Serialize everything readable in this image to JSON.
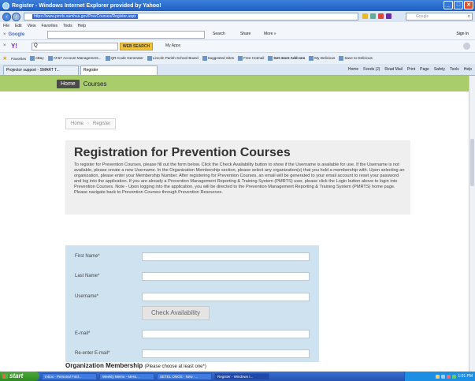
{
  "window": {
    "title": "Register - Windows Internet Explorer provided by Yahoo!",
    "min_label": "_",
    "max_label": "□",
    "close_label": "✕"
  },
  "address": {
    "url": "https://www.pmrts.samhsa.gov/PrevCourses/Register.aspx",
    "search_placeholder": "Google"
  },
  "menu": [
    "File",
    "Edit",
    "View",
    "Favorites",
    "Tools",
    "Help"
  ],
  "google_bar": {
    "logo": "Google",
    "search_label": "Search",
    "share_label": "Share",
    "more_label": "More »",
    "signin_label": "Sign In"
  },
  "yahoo_bar": {
    "logo": "Y!",
    "search_value": "Q",
    "search_button": "WEB SEARCH",
    "myapps_label": "My Apps"
  },
  "favorites": {
    "label": "Favorites",
    "items": [
      "eBay",
      "AT&T Account Management...",
      "QR-Code Generator",
      "Lincoln Parish School Board",
      "Suggested Sites",
      "Free Hotmail",
      "Get more Add-ons",
      "My Delicious",
      "Save to Delicious"
    ]
  },
  "tabs": [
    {
      "label": "Projector support - SMART T..."
    },
    {
      "label": "Register"
    }
  ],
  "commandbar": [
    "Home",
    "Feeds (J)",
    "Read Mail",
    "Print",
    "Page",
    "Safety",
    "Tools",
    "Help"
  ],
  "page": {
    "nav_home": "Home",
    "nav_title": "Courses",
    "breadcrumb": [
      "Home",
      "Register"
    ],
    "heading": "Registration for Prevention Courses",
    "intro": "To register for Prevention Courses, please fill out the form below. Click the Check Availability button to show if the Username is available for use. If the Username is not available, please create a new Username. In the Organization Membership section, please select any organization(s) that you hold a membership with. Upon selecting an organization, please enter your Membership Number. After registering for Prevention Courses, an email will be generated to your email account to reset your password and log into the application. If you are already a Prevention Management Reporting & Training System (PMRTS) user, please click the Login button above to login into Prevention Courses. Note - Upon logging into the application, you will be directed to the Prevention Management Reporting & Training System (PMRTS) home page. Please navigate back to Prevention Courses through Prevention Resources.",
    "form": {
      "first_name_label": "First Name*",
      "last_name_label": "Last Name*",
      "username_label": "Username*",
      "check_button": "Check Availability",
      "email_label": "E-mail*",
      "reenter_email_label": "Re-enter E-mail*"
    },
    "org_membership_title": "Organization Membership",
    "org_membership_sub": "(Please choose at least one*)"
  },
  "taskbar": {
    "start_label": "start",
    "tasks": [
      "Inbox - Personal Fold...",
      "Weekly Memo - Mess...",
      "SETEL ONOS - New -...",
      "Register - Windows I..."
    ],
    "clock": "1:01 PM"
  }
}
